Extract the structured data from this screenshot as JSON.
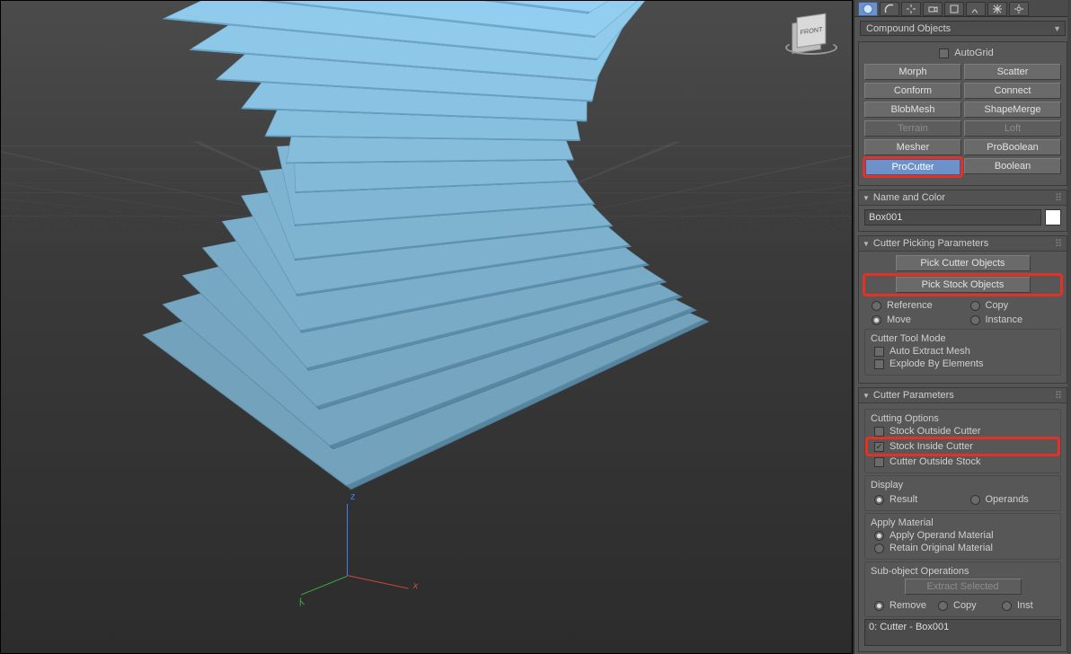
{
  "dropdown": {
    "label": "Compound Objects"
  },
  "autogrid": {
    "label": "AutoGrid",
    "checked": false
  },
  "object_buttons": [
    {
      "label": "Morph",
      "state": "normal"
    },
    {
      "label": "Scatter",
      "state": "normal"
    },
    {
      "label": "Conform",
      "state": "normal"
    },
    {
      "label": "Connect",
      "state": "normal"
    },
    {
      "label": "BlobMesh",
      "state": "normal"
    },
    {
      "label": "ShapeMerge",
      "state": "normal"
    },
    {
      "label": "Terrain",
      "state": "disabled"
    },
    {
      "label": "Loft",
      "state": "disabled"
    },
    {
      "label": "Mesher",
      "state": "normal"
    },
    {
      "label": "ProBoolean",
      "state": "normal"
    },
    {
      "label": "ProCutter",
      "state": "active"
    },
    {
      "label": "Boolean",
      "state": "normal"
    }
  ],
  "rollouts": {
    "name_color": {
      "title": "Name and Color",
      "object_name": "Box001",
      "swatch": "#ffffff"
    },
    "cutter_picking": {
      "title": "Cutter Picking Parameters",
      "pick_cutter": "Pick Cutter Objects",
      "pick_stock": "Pick Stock Objects",
      "clone_modes": {
        "reference": "Reference",
        "copy": "Copy",
        "move": "Move",
        "instance": "Instance",
        "selected": "move"
      },
      "tool_mode": {
        "label": "Cutter Tool Mode",
        "auto_extract": {
          "label": "Auto Extract Mesh",
          "checked": false
        },
        "explode": {
          "label": "Explode By Elements",
          "checked": false
        }
      }
    },
    "cutter_params": {
      "title": "Cutter Parameters",
      "cutting_options": {
        "label": "Cutting Options",
        "stock_outside_cutter": {
          "label": "Stock Outside Cutter",
          "checked": false
        },
        "stock_inside_cutter": {
          "label": "Stock Inside Cutter",
          "checked": true
        },
        "cutter_outside_stock": {
          "label": "Cutter Outside Stock",
          "checked": false
        }
      },
      "display": {
        "label": "Display",
        "result": "Result",
        "operands": "Operands",
        "selected": "result"
      },
      "apply_material": {
        "label": "Apply Material",
        "operand": "Apply Operand Material",
        "original": "Retain Original Material",
        "selected": "operand"
      },
      "subobj": {
        "label": "Sub-object Operations",
        "extract": "Extract Selected",
        "remove": "Remove",
        "copy": "Copy",
        "inst": "Inst",
        "selected": "remove"
      },
      "operands_list": "0: Cutter - Box001"
    }
  }
}
